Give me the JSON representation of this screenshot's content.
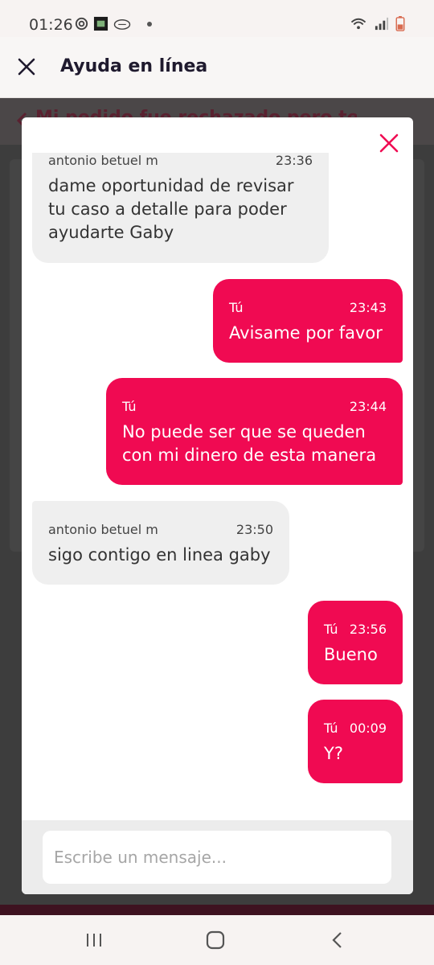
{
  "status_bar": {
    "time": "01:26",
    "left_icons": [
      "sync-icon",
      "app-logo-icon",
      "cloud-icon"
    ],
    "right_icons": [
      "wifi-icon",
      "signal-icon",
      "battery-icon"
    ]
  },
  "header": {
    "title": "Ayuda en línea",
    "close_icon": "close-icon"
  },
  "background_page": {
    "strip_text": "Mi pedido fue rechazado pero tengo el cargo"
  },
  "chat": {
    "messages": [
      {
        "sender": "antonio betuel m",
        "time": "23:36",
        "text_lines": [
          "dame oportunidad de revisar",
          "tu caso a detalle para poder",
          "ayudarte Gaby"
        ],
        "from": "agent"
      },
      {
        "sender": "Tú",
        "time": "23:43",
        "text_lines": [
          "Avisame por favor"
        ],
        "from": "user"
      },
      {
        "sender": "Tú",
        "time": "23:44",
        "text_lines": [
          "No puede ser que se queden",
          "con mi dinero de esta manera"
        ],
        "from": "user"
      },
      {
        "sender": "antonio betuel m",
        "time": "23:50",
        "text_lines": [
          "sigo contigo en linea gaby"
        ],
        "from": "agent"
      },
      {
        "sender": "Tú",
        "time": "23:56",
        "text_lines": [
          "Bueno"
        ],
        "from": "user"
      },
      {
        "sender": "Tú",
        "time": "00:09",
        "text_lines": [
          "Y?"
        ],
        "from": "user"
      }
    ]
  },
  "composer": {
    "placeholder": "Escribe un mensaje...",
    "value": ""
  },
  "colors": {
    "accent": "#f00a52",
    "agent_bubble": "#efefef",
    "header_title": "#1f1a2e"
  }
}
